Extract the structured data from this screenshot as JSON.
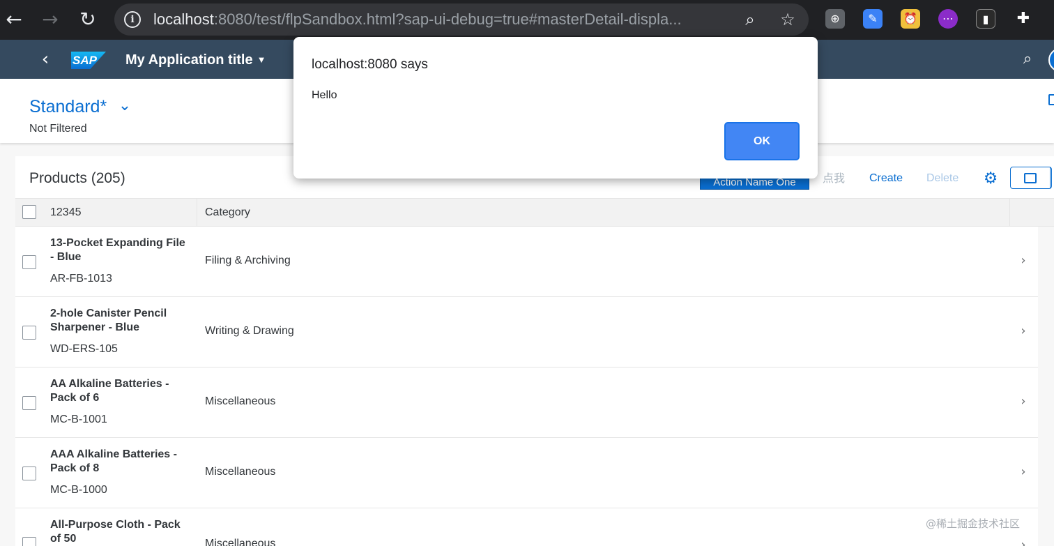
{
  "browser": {
    "url_host": "localhost",
    "url_rest": ":8080/test/flpSandbox.html?sap-ui-debug=true#masterDetail-displa...",
    "icons": [
      "back-arrow-icon",
      "forward-arrow-icon",
      "reload-icon",
      "info-icon",
      "zoom-icon",
      "star-icon",
      "puzzle-extensions-icon"
    ]
  },
  "shell": {
    "logo_text": "SAP",
    "app_title": "My Application title"
  },
  "header": {
    "variant": "Standard*",
    "filter_status": "Not Filtered"
  },
  "table": {
    "title": "Products (205)",
    "toolbar": {
      "action_one": "Action Name One",
      "dianwo": "点我",
      "create": "Create",
      "delete": "Delete"
    },
    "columns": [
      "12345",
      "Category"
    ],
    "rows": [
      {
        "name": "13-Pocket Expanding File - Blue",
        "id": "AR-FB-1013",
        "category": "Filing & Archiving"
      },
      {
        "name": "2-hole Canister Pencil Sharpener - Blue",
        "id": "WD-ERS-105",
        "category": "Writing & Drawing"
      },
      {
        "name": "AA Alkaline Batteries - Pack of 6",
        "id": "MC-B-1001",
        "category": "Miscellaneous"
      },
      {
        "name": "AAA Alkaline Batteries - Pack of 8",
        "id": "MC-B-1000",
        "category": "Miscellaneous"
      },
      {
        "name": "All-Purpose Cloth - Pack of 50",
        "id": "",
        "category": "Miscellaneous"
      }
    ]
  },
  "dialog": {
    "title": "localhost:8080 says",
    "message": "Hello",
    "ok_label": "OK"
  },
  "watermark": "@稀土掘金技术社区",
  "colors": {
    "shell_bg": "#354a5f",
    "accent": "#0a6ed1",
    "chrome_bg": "#202124",
    "dialog_button": "#4286f4"
  }
}
